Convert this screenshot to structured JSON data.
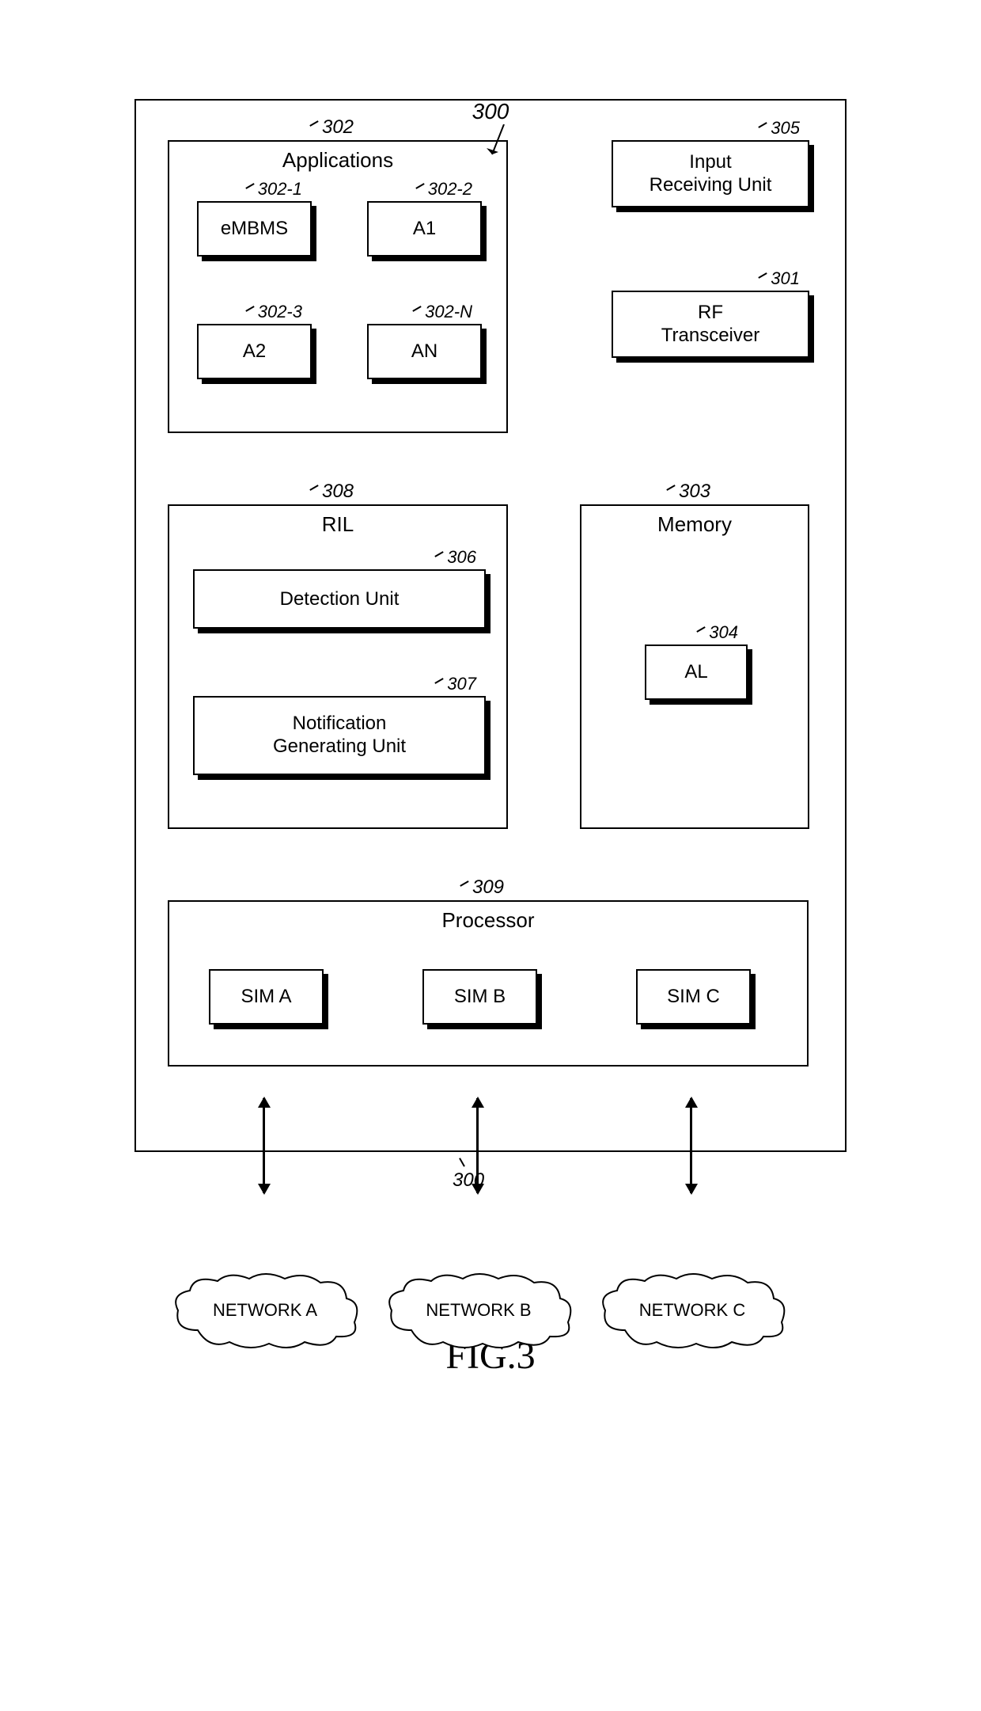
{
  "figure": {
    "topLabel": "300",
    "title": "FIG.3"
  },
  "applications": {
    "label": "302",
    "title": "Applications",
    "items": [
      {
        "label": "302-1",
        "text": "eMBMS"
      },
      {
        "label": "302-2",
        "text": "A1"
      },
      {
        "label": "302-3",
        "text": "A2"
      },
      {
        "label": "302-N",
        "text": "AN"
      }
    ]
  },
  "inputReceiving": {
    "label": "305",
    "text": "Input Receiving Unit"
  },
  "rfTransceiver": {
    "label": "301",
    "text": "RF Transceiver"
  },
  "ril": {
    "label": "308",
    "title": "RIL",
    "detection": {
      "label": "306",
      "text": "Detection Unit"
    },
    "notification": {
      "label": "307",
      "text": "Notification Generating Unit"
    }
  },
  "memory": {
    "label": "303",
    "title": "Memory",
    "al": {
      "label": "304",
      "text": "AL"
    }
  },
  "processor": {
    "label": "309",
    "title": "Processor",
    "sims": [
      {
        "text": "SIM A"
      },
      {
        "text": "SIM B"
      },
      {
        "text": "SIM C"
      }
    ]
  },
  "connectorLabel": "300",
  "networks": [
    {
      "text": "NETWORK A"
    },
    {
      "text": "NETWORK B"
    },
    {
      "text": "NETWORK C"
    }
  ]
}
